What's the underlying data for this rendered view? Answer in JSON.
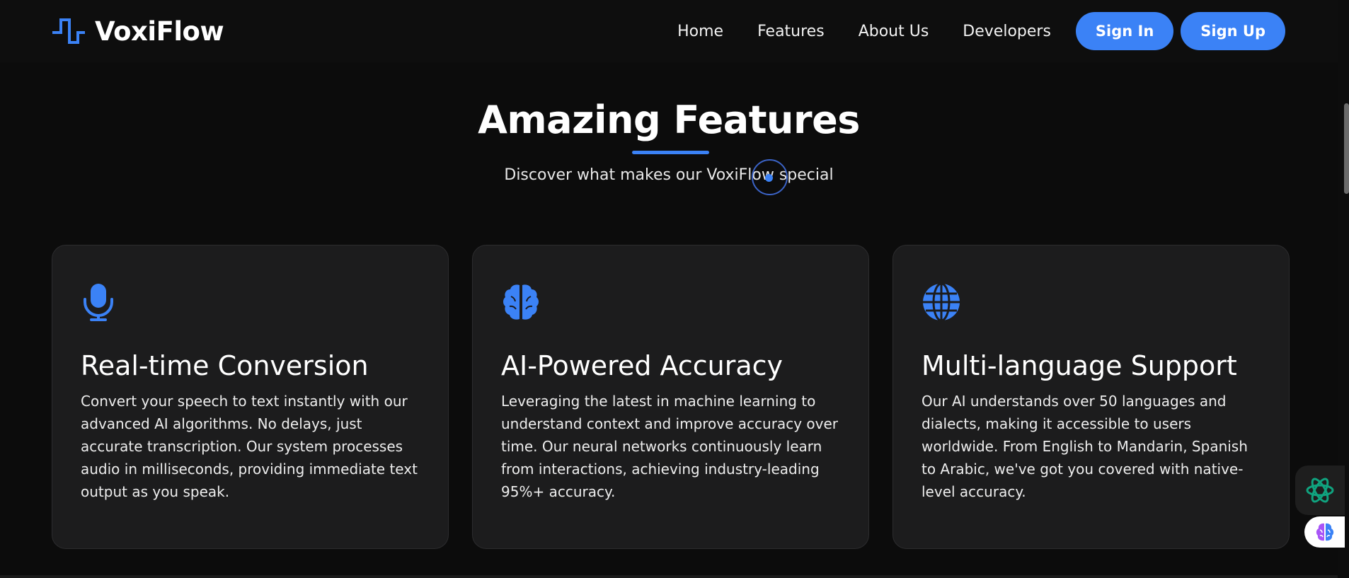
{
  "brand": {
    "name": "VoxiFlow",
    "logo_icon": "waveform-logo-icon",
    "accent": "#3b82f6"
  },
  "nav": {
    "links": [
      "Home",
      "Features",
      "About Us",
      "Developers"
    ],
    "sign_in": "Sign In",
    "sign_up": "Sign Up"
  },
  "section": {
    "title": "Amazing Features",
    "subtitle": "Discover what makes our VoxiFlow special"
  },
  "cards": [
    {
      "icon": "microphone-icon",
      "title": "Real-time Conversion",
      "text": "Convert your speech to text instantly with our advanced AI algorithms. No delays, just accurate transcription. Our system processes audio in milliseconds, providing immediate text output as you speak."
    },
    {
      "icon": "brain-icon",
      "title": "AI-Powered Accuracy",
      "text": "Leveraging the latest in machine learning to understand context and improve accuracy over time. Our neural networks continuously learn from interactions, achieving industry-leading 95%+ accuracy."
    },
    {
      "icon": "globe-icon",
      "title": "Multi-language Support",
      "text": "Our AI understands over 50 languages and dialects, making it accessible to users worldwide. From English to Mandarin, Spanish to Arabic, we've got you covered with native-level accuracy."
    }
  ],
  "widgets": {
    "ai_assistant_icon": "openai-knot-icon",
    "brain_extension_icon": "brain-extension-icon"
  },
  "colors": {
    "background": "#0c0c0c",
    "card": "#1c1c1d",
    "accent": "#3b82f6"
  }
}
